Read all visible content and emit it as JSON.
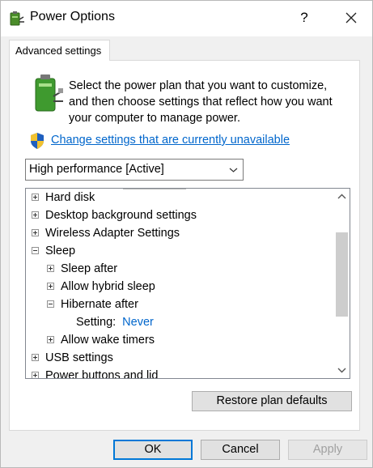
{
  "window": {
    "title": "Power Options",
    "help_label": "?",
    "icons": {
      "app": "power-options-icon",
      "close": "close-icon"
    }
  },
  "tab": {
    "label": "Advanced settings"
  },
  "description": "Select the power plan that you want to customize, and then choose settings that reflect how you want your computer to manage power.",
  "change_link": {
    "label": "Change settings that are currently unavailable",
    "icon": "uac-shield-icon"
  },
  "plan_select": {
    "selected": "High performance [Active]"
  },
  "tree": {
    "items": [
      {
        "label": "Hard disk",
        "state": "collapsed"
      },
      {
        "label": "Desktop background settings",
        "state": "collapsed"
      },
      {
        "label": "Wireless Adapter Settings",
        "state": "collapsed"
      },
      {
        "label": "Sleep",
        "state": "expanded"
      },
      {
        "label": "Sleep after",
        "state": "collapsed"
      },
      {
        "label": "Allow hybrid sleep",
        "state": "collapsed"
      },
      {
        "label": "Hibernate after",
        "state": "expanded"
      },
      {
        "label": "Setting:",
        "value": "Never"
      },
      {
        "label": "Allow wake timers",
        "state": "collapsed"
      },
      {
        "label": "USB settings",
        "state": "collapsed"
      },
      {
        "label": "Power buttons and lid",
        "state": "collapsed"
      }
    ]
  },
  "buttons": {
    "restore": "Restore plan defaults",
    "ok": "OK",
    "cancel": "Cancel",
    "apply": "Apply"
  },
  "colors": {
    "link": "#0066cc",
    "focus_border": "#0078d7",
    "dialog_bg": "#f0f0f0"
  }
}
